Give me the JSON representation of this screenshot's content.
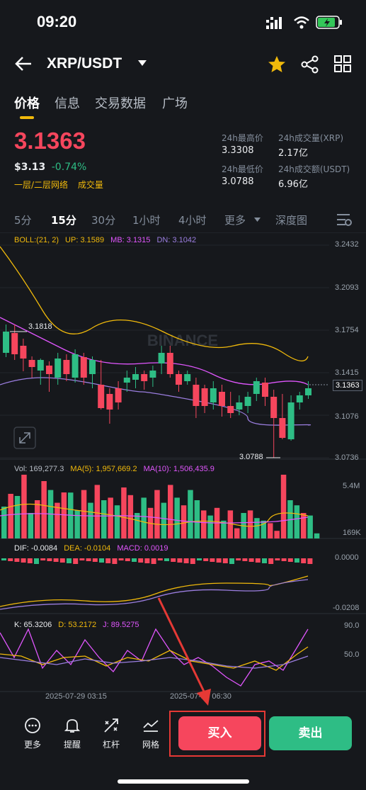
{
  "status_bar": {
    "time": "09:20"
  },
  "header": {
    "pair": "XRP/USDT"
  },
  "tabs": [
    "价格",
    "信息",
    "交易数据",
    "广场"
  ],
  "price": {
    "last": "3.1363",
    "fiat": "$3.13",
    "change": "-0.74%",
    "network": "一层/二层网络",
    "volume_tag": "成交量"
  },
  "stats": {
    "high_label": "24h最高价",
    "high_value": "3.3308",
    "low_label": "24h最低价",
    "low_value": "3.0788",
    "vol_label": "24h成交量(XRP)",
    "vol_value": "2.17亿",
    "amount_label": "24h成交额(USDT)",
    "amount_value": "6.96亿"
  },
  "intervals": [
    "5分",
    "15分",
    "30分",
    "1小时",
    "4小时",
    "更多",
    "深度图"
  ],
  "indicators": {
    "boll": "BOLL:(21, 2)",
    "up": "UP: 3.1589",
    "mb": "MB: 3.1315",
    "dn": "DN: 3.1042",
    "vol": "Vol: 169,277.3",
    "ma5": "MA(5): 1,957,669.2",
    "ma10": "MA(10): 1,506,435.9",
    "dif": "DIF: -0.0084",
    "dea": "DEA: -0.0104",
    "macd": "MACD: 0.0019",
    "k": "K: 65.3206",
    "d": "D: 53.2172",
    "j": "J: 89.5275"
  },
  "axis": {
    "price_ticks": [
      "3.2432",
      "3.2093",
      "3.1754",
      "3.1415",
      "3.1076",
      "3.0736"
    ],
    "current_price": "3.1363",
    "high_marker": "3.1818",
    "low_marker": "3.0788",
    "vol_ticks": [
      "5.4M",
      "169K"
    ],
    "macd_ticks": [
      "0.0000",
      "-0.0208"
    ],
    "kdj_ticks": [
      "90.0",
      "50.0"
    ],
    "time_labels": [
      "2025-07-29 03:15",
      "2025-07-29 06:30"
    ]
  },
  "watermark": "BINANCE",
  "bottom": {
    "more": "更多",
    "alert": "提醒",
    "leverage": "杠杆",
    "grid": "网格",
    "buy": "买入",
    "sell": "卖出"
  },
  "colors": {
    "up": "#2ebd85",
    "down": "#f6465d",
    "accent": "#f0b90b",
    "background": "#16181c"
  }
}
